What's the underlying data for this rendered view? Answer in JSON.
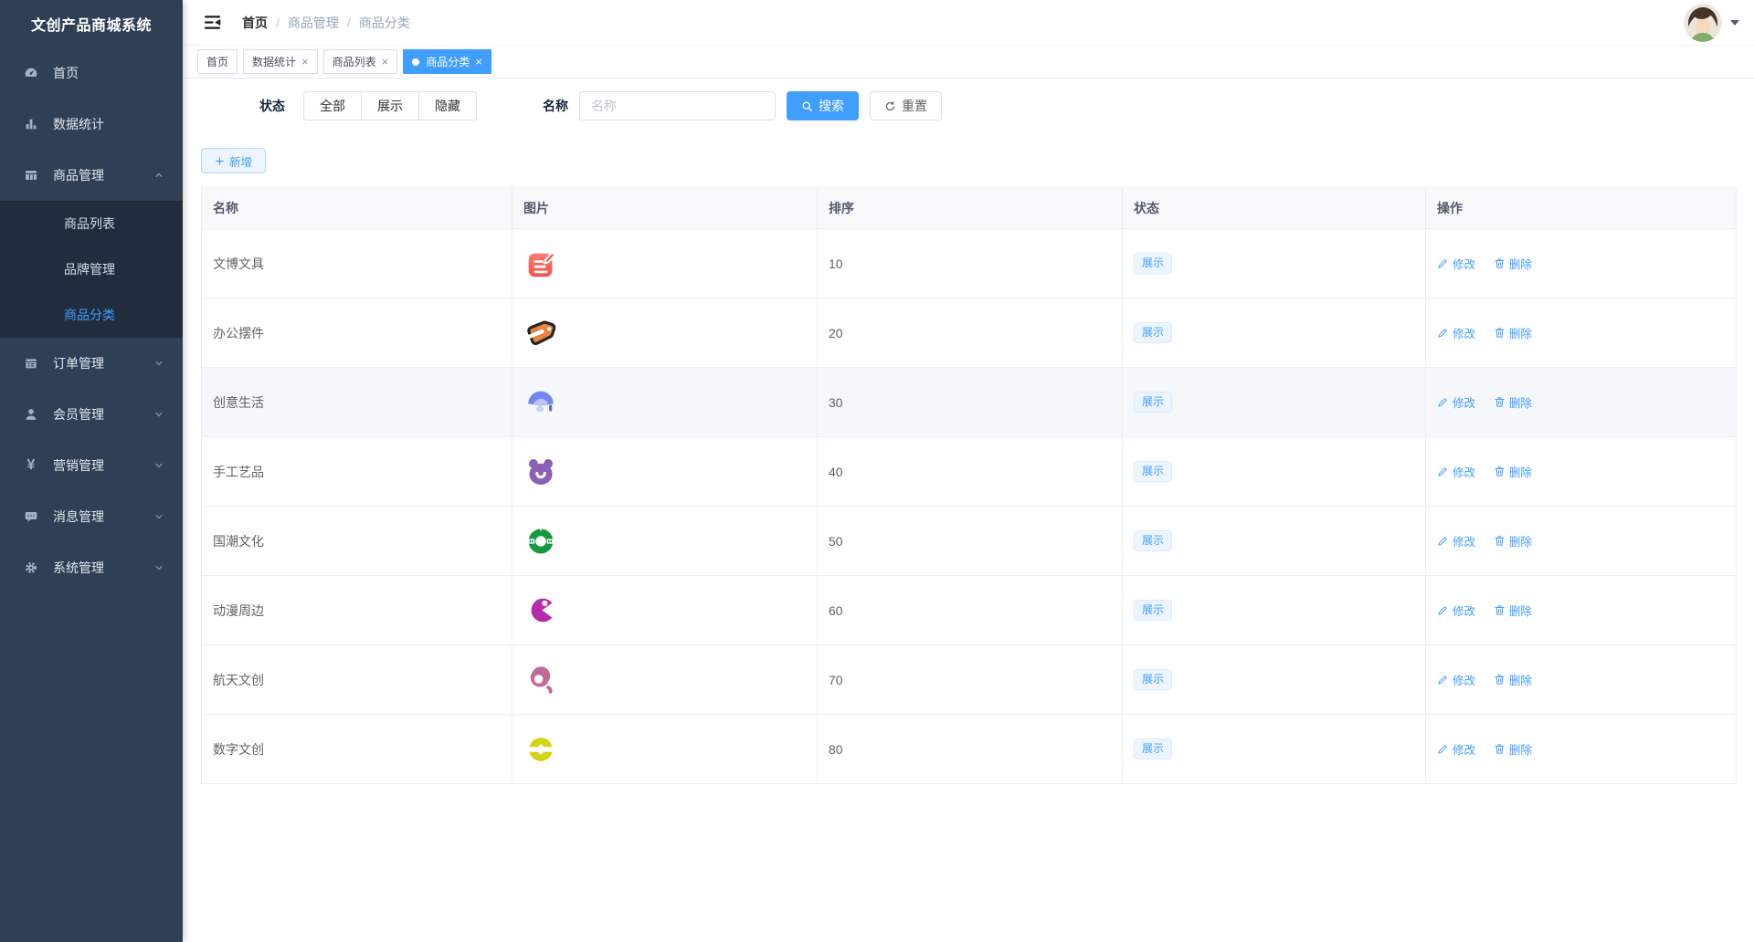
{
  "app": {
    "title": "文创产品商城系统"
  },
  "sidebar": {
    "items": [
      {
        "label": "首页",
        "icon": "dashboard-icon"
      },
      {
        "label": "数据统计",
        "icon": "bar-chart-icon"
      },
      {
        "label": "商品管理",
        "icon": "grid-icon",
        "expanded": true,
        "children": [
          "商品列表",
          "品牌管理",
          "商品分类"
        ],
        "active_child": "商品分类"
      },
      {
        "label": "订单管理",
        "icon": "order-icon"
      },
      {
        "label": "会员管理",
        "icon": "user-icon"
      },
      {
        "label": "营销管理",
        "icon": "yen-icon"
      },
      {
        "label": "消息管理",
        "icon": "message-icon"
      },
      {
        "label": "系统管理",
        "icon": "gear-icon"
      }
    ]
  },
  "breadcrumb": {
    "items": [
      "首页",
      "商品管理",
      "商品分类"
    ],
    "separator": "/"
  },
  "tabs": [
    {
      "label": "首页",
      "closable": false,
      "active": false
    },
    {
      "label": "数据统计",
      "closable": true,
      "active": false
    },
    {
      "label": "商品列表",
      "closable": true,
      "active": false
    },
    {
      "label": "商品分类",
      "closable": true,
      "active": true
    }
  ],
  "filters": {
    "status_label": "状态",
    "status_options": [
      "全部",
      "展示",
      "隐藏"
    ],
    "name_label": "名称",
    "name_placeholder": "名称",
    "name_value": "",
    "search_label": "搜索",
    "reset_label": "重置"
  },
  "toolbar": {
    "add_label": "新增"
  },
  "table": {
    "headers": [
      "名称",
      "图片",
      "排序",
      "状态",
      "操作"
    ],
    "actions": {
      "modify": "修改",
      "delete": "删除"
    },
    "rows": [
      {
        "name": "文博文具",
        "sort": "10",
        "status": "展示",
        "icon": "note-edit-icon",
        "icon_color": "#f6564f"
      },
      {
        "name": "办公摆件",
        "sort": "20",
        "status": "展示",
        "icon": "price-tag-icon",
        "icon_color": "#e8843c"
      },
      {
        "name": "创意生活",
        "sort": "30",
        "status": "展示",
        "icon": "folding-fan-icon",
        "icon_color": "#7487f2"
      },
      {
        "name": "手工艺品",
        "sort": "40",
        "status": "展示",
        "icon": "bear-icon",
        "icon_color": "#8a5fb5"
      },
      {
        "name": "国潮文化",
        "sort": "50",
        "status": "展示",
        "icon": "jade-ring-icon",
        "icon_color": "#169a3e"
      },
      {
        "name": "动漫周边",
        "sort": "60",
        "status": "展示",
        "icon": "pacman-icon",
        "icon_color": "#b52bab"
      },
      {
        "name": "航天文创",
        "sort": "70",
        "status": "展示",
        "icon": "planet-icon",
        "icon_color": "#bf6b9b"
      },
      {
        "name": "数字文创",
        "sort": "80",
        "status": "展示",
        "icon": "coin-icon",
        "icon_color": "#d3d414"
      }
    ]
  },
  "colors": {
    "accent": "#409eff",
    "sidebar_bg": "#2f4056",
    "submenu_bg": "#212d3d",
    "status_tag_bg": "#ecf5ff",
    "status_tag_border": "#d9ecff",
    "table_header_bg": "#f8f9fb",
    "row_hover_bg": "#f5f7fa"
  }
}
